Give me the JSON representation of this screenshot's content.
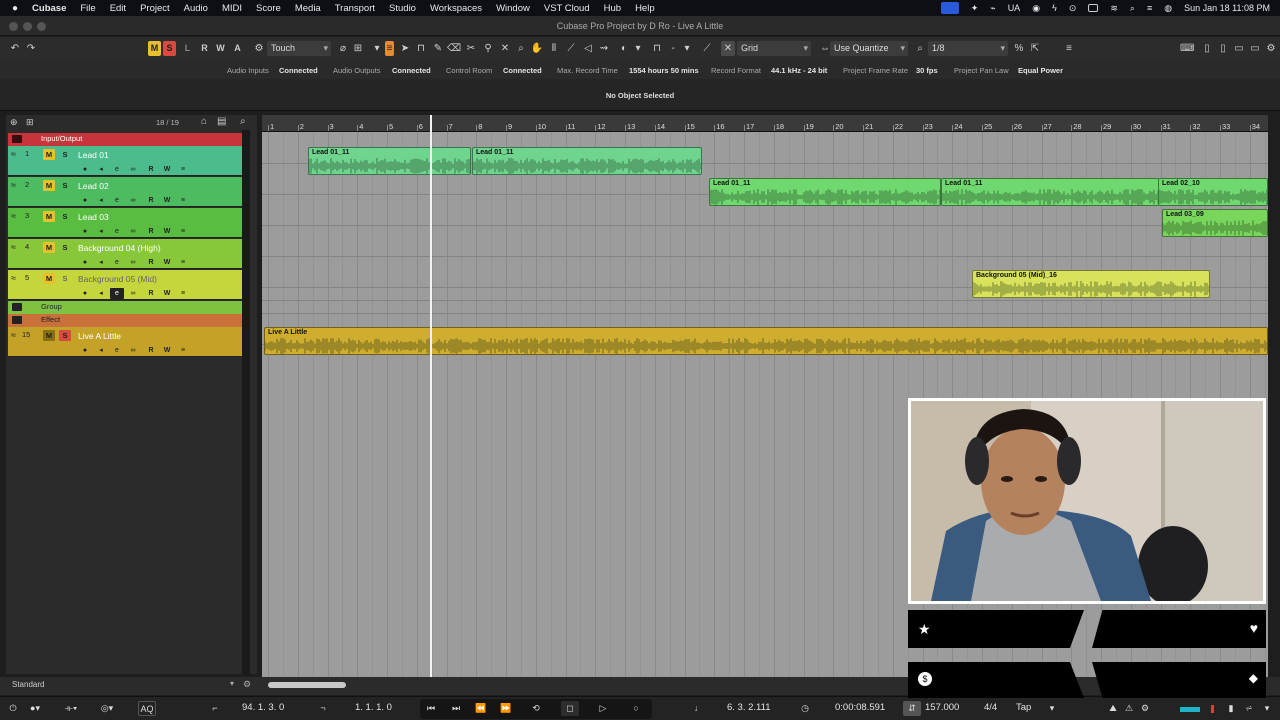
{
  "menubar": {
    "app_name": "Cubase",
    "items": [
      "File",
      "Edit",
      "Project",
      "Audio",
      "MIDI",
      "Score",
      "Media",
      "Transport",
      "Studio",
      "Workspaces",
      "Window",
      "VST Cloud",
      "Hub",
      "Help"
    ],
    "keyboard_layout": "UA",
    "clock": "Sun Jan 18  11:08 PM"
  },
  "window": {
    "title": "Cubase Pro Project by D Ro - Live A Little"
  },
  "toolbar": {
    "m": "M",
    "s": "S",
    "l": "L",
    "r": "R",
    "w": "W",
    "a": "A",
    "automation_mode": "Touch",
    "snap_type": "Grid",
    "quantize_mode": "Use Quantize",
    "quantize_value": "1/8"
  },
  "status": {
    "audio_inputs_label": "Audio Inputs",
    "audio_inputs_value": "Connected",
    "audio_outputs_label": "Audio Outputs",
    "audio_outputs_value": "Connected",
    "control_room_label": "Control Room",
    "control_room_value": "Connected",
    "max_record_label": "Max. Record Time",
    "max_record_value": "1554 hours 50 mins",
    "record_format_label": "Record Format",
    "record_format_value": "44.1 kHz - 24 bit",
    "frame_rate_label": "Project Frame Rate",
    "frame_rate_value": "30 fps",
    "pan_law_label": "Project Pan Law",
    "pan_law_value": "Equal Power"
  },
  "info_line": "No Object Selected",
  "tracklist": {
    "count": "18 / 19",
    "folders": {
      "io": "Input/Output",
      "group": "Group",
      "effect": "Effect"
    },
    "tracks": [
      {
        "num": "1",
        "name": "Lead 01",
        "color": "#4cbc8c"
      },
      {
        "num": "2",
        "name": "Lead 02",
        "color": "#4dbb60"
      },
      {
        "num": "3",
        "name": "Lead 03",
        "color": "#58bd40"
      },
      {
        "num": "4",
        "name": "Background 04 (High)",
        "color": "#88c63a"
      },
      {
        "num": "5",
        "name": "Background 05 (Mid)",
        "color": "#c4d63c"
      },
      {
        "num": "15",
        "name": "Live A Little",
        "color": "#c4a227"
      }
    ],
    "btn_m": "M",
    "btn_s": "S",
    "btn_r": "R",
    "btn_w": "W",
    "btn_e": "e",
    "footer_label": "Standard"
  },
  "ruler": {
    "bars": [
      "1",
      "2",
      "3",
      "4",
      "5",
      "6",
      "7",
      "8",
      "9",
      "10",
      "11",
      "12",
      "13",
      "14",
      "15",
      "16",
      "17",
      "18",
      "19",
      "20",
      "21",
      "22",
      "23",
      "24",
      "25",
      "26",
      "27",
      "28",
      "29",
      "30",
      "31",
      "32",
      "33",
      "34"
    ]
  },
  "events": [
    {
      "name": "Lead 01_11",
      "color": "#6ed48e"
    },
    {
      "name": "Lead 01_11",
      "color": "#6ed48e"
    },
    {
      "name": "Lead 01_11",
      "color": "#6fd86f"
    },
    {
      "name": "Lead 01_11",
      "color": "#6fd86f"
    },
    {
      "name": "Lead 02_10",
      "color": "#6fd86f"
    },
    {
      "name": "Lead 03_09",
      "color": "#78d65c"
    },
    {
      "name": "Background 05 (Mid)_16",
      "color": "#d8e25a"
    },
    {
      "name": "Live A Little",
      "color": "#cfad2e"
    }
  ],
  "transport": {
    "left_locator": "94. 1. 3.   0",
    "right_locator": "1. 1. 1.   0",
    "position_bars": "6. 3. 2.111",
    "position_time": "0:00:08.591",
    "tempo": "157.000",
    "signature": "4/4",
    "tap": "Tap",
    "aq": "AQ"
  }
}
